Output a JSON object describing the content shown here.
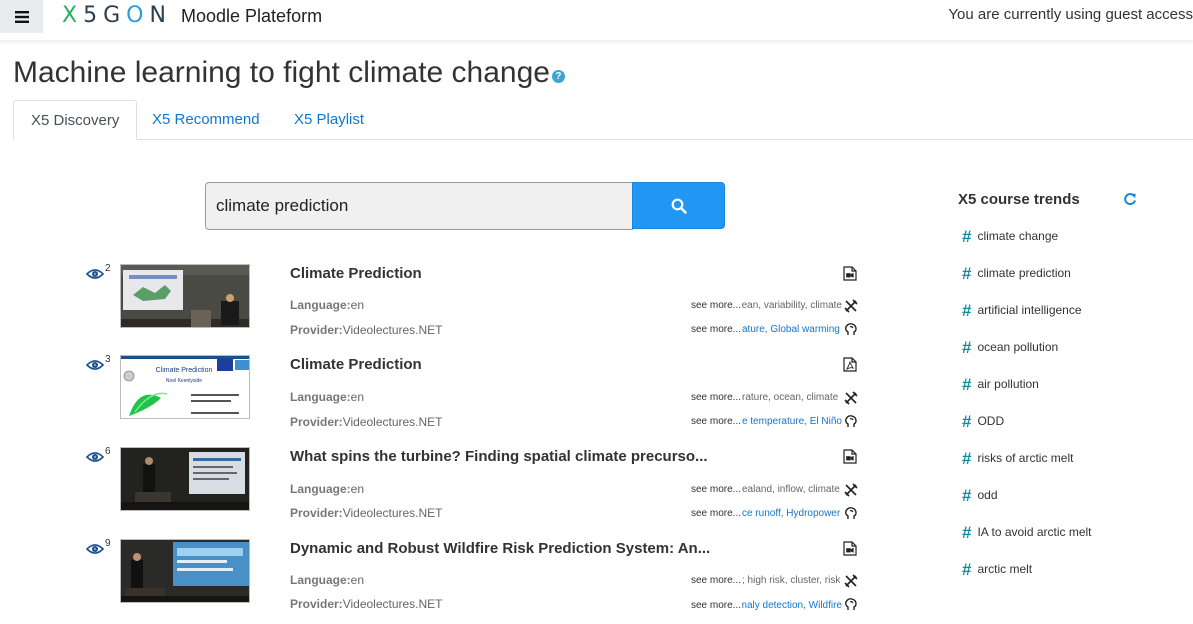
{
  "navbar": {
    "logo_letters": [
      "X",
      "5",
      "G",
      "O",
      "N"
    ],
    "site_name": "Moodle Plateform",
    "guest_text": "You are currently using guest access"
  },
  "page": {
    "title": "Machine learning to fight climate change",
    "help_label": "?"
  },
  "tabs": [
    {
      "label": "X5 Discovery",
      "active": true
    },
    {
      "label": "X5 Recommend",
      "active": false
    },
    {
      "label": "X5 Playlist",
      "active": false
    }
  ],
  "search": {
    "value": "climate prediction",
    "button_icon": "search-icon"
  },
  "labels": {
    "language": "Language:",
    "provider": "Provider:",
    "see_more": "see more..."
  },
  "results": [
    {
      "views": "2",
      "title": "Climate Prediction",
      "type_icon": "video-file-icon",
      "language": "en",
      "provider": "Videolectures.NET",
      "keywords": "ean, variability, climate",
      "concepts": "ature, Global warming"
    },
    {
      "views": "3",
      "title": "Climate Prediction",
      "type_icon": "pdf-file-icon",
      "language": "en",
      "provider": "Videolectures.NET",
      "keywords": "rature, ocean, climate",
      "concepts": "e temperature, El Niño"
    },
    {
      "views": "6",
      "title": "What spins the turbine? Finding spatial climate precurso...",
      "type_icon": "video-file-icon",
      "language": "en",
      "provider": "Videolectures.NET",
      "keywords": "ealand, inflow, climate",
      "concepts": "ce runoff, Hydropower"
    },
    {
      "views": "9",
      "title": "Dynamic and Robust Wildfire Risk Prediction System: An...",
      "type_icon": "video-file-icon",
      "language": "en",
      "provider": "Videolectures.NET",
      "keywords": "; high risk, cluster, risk",
      "concepts": "maly detection, Wildfire"
    }
  ],
  "thumb2": {
    "title": "Climate Prediction",
    "author": "Noel Keenlyside"
  },
  "trends": {
    "title": "X5 course trends",
    "items": [
      "climate change",
      "climate prediction",
      "artificial intelligence",
      "ocean pollution",
      "air pollution",
      "ODD",
      "risks of arctic melt",
      "odd",
      "IA to avoid arctic melt",
      "arctic melt"
    ]
  },
  "colors": {
    "link": "#1177d1",
    "search_button": "#2196f3",
    "hash": "#1a8ca0"
  }
}
